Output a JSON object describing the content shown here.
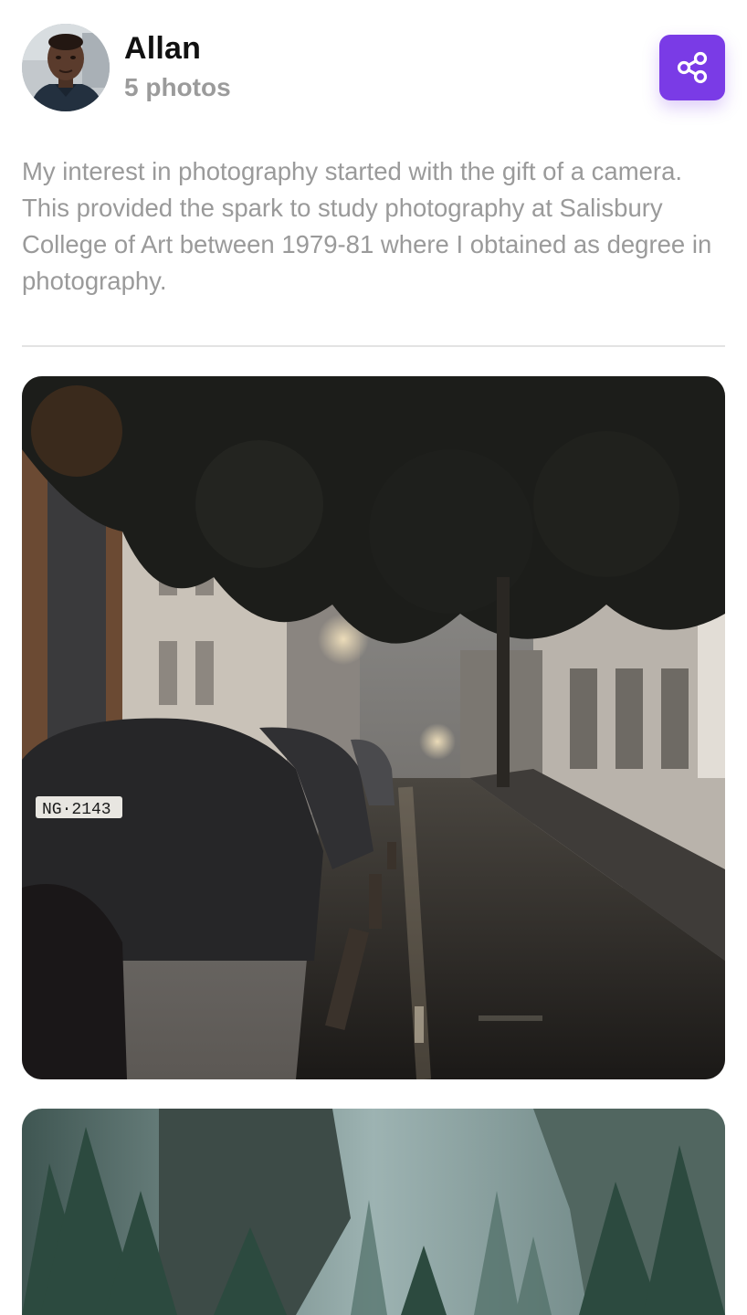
{
  "profile": {
    "name": "Allan",
    "photo_count": "5 photos",
    "avatar_icon": "avatar-portrait",
    "bio": "My interest in photography started with the gift of a camera. This provided the spark to study photography at Salisbury College of Art between 1979-81 where I obtained as degree in photography."
  },
  "actions": {
    "share_icon": "share-icon"
  },
  "colors": {
    "accent": "#7a3be6",
    "name_text": "#111111",
    "muted_text": "#9a9a9a",
    "divider": "#e3e3e3"
  },
  "gallery": {
    "photos": [
      {
        "alt": "rainy city street at night"
      },
      {
        "alt": "misty pine forest"
      }
    ],
    "plate_text": "NG·2143"
  }
}
